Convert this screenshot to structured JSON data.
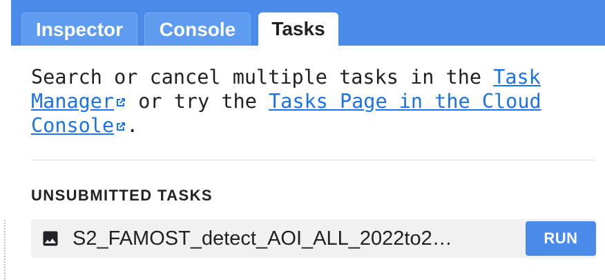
{
  "tabs": [
    {
      "label": "Inspector",
      "active": false
    },
    {
      "label": "Console",
      "active": false
    },
    {
      "label": "Tasks",
      "active": true
    }
  ],
  "intro": {
    "text_1": "Search or cancel multiple tasks in the ",
    "link_task_manager": "Task Manager",
    "text_2": " or try the ",
    "link_cloud_console": "Tasks Page in the Cloud Console",
    "text_3": "."
  },
  "unsubmitted": {
    "title": "UNSUBMITTED TASKS",
    "tasks": [
      {
        "name": "S2_FAMOST_detect_AOI_ALL_2022to2…",
        "icon": "image-icon",
        "run_label": "RUN"
      }
    ]
  },
  "colors": {
    "accent": "#4a8ae8",
    "link": "#1a73e8",
    "row_bg": "#f1f1f1"
  }
}
